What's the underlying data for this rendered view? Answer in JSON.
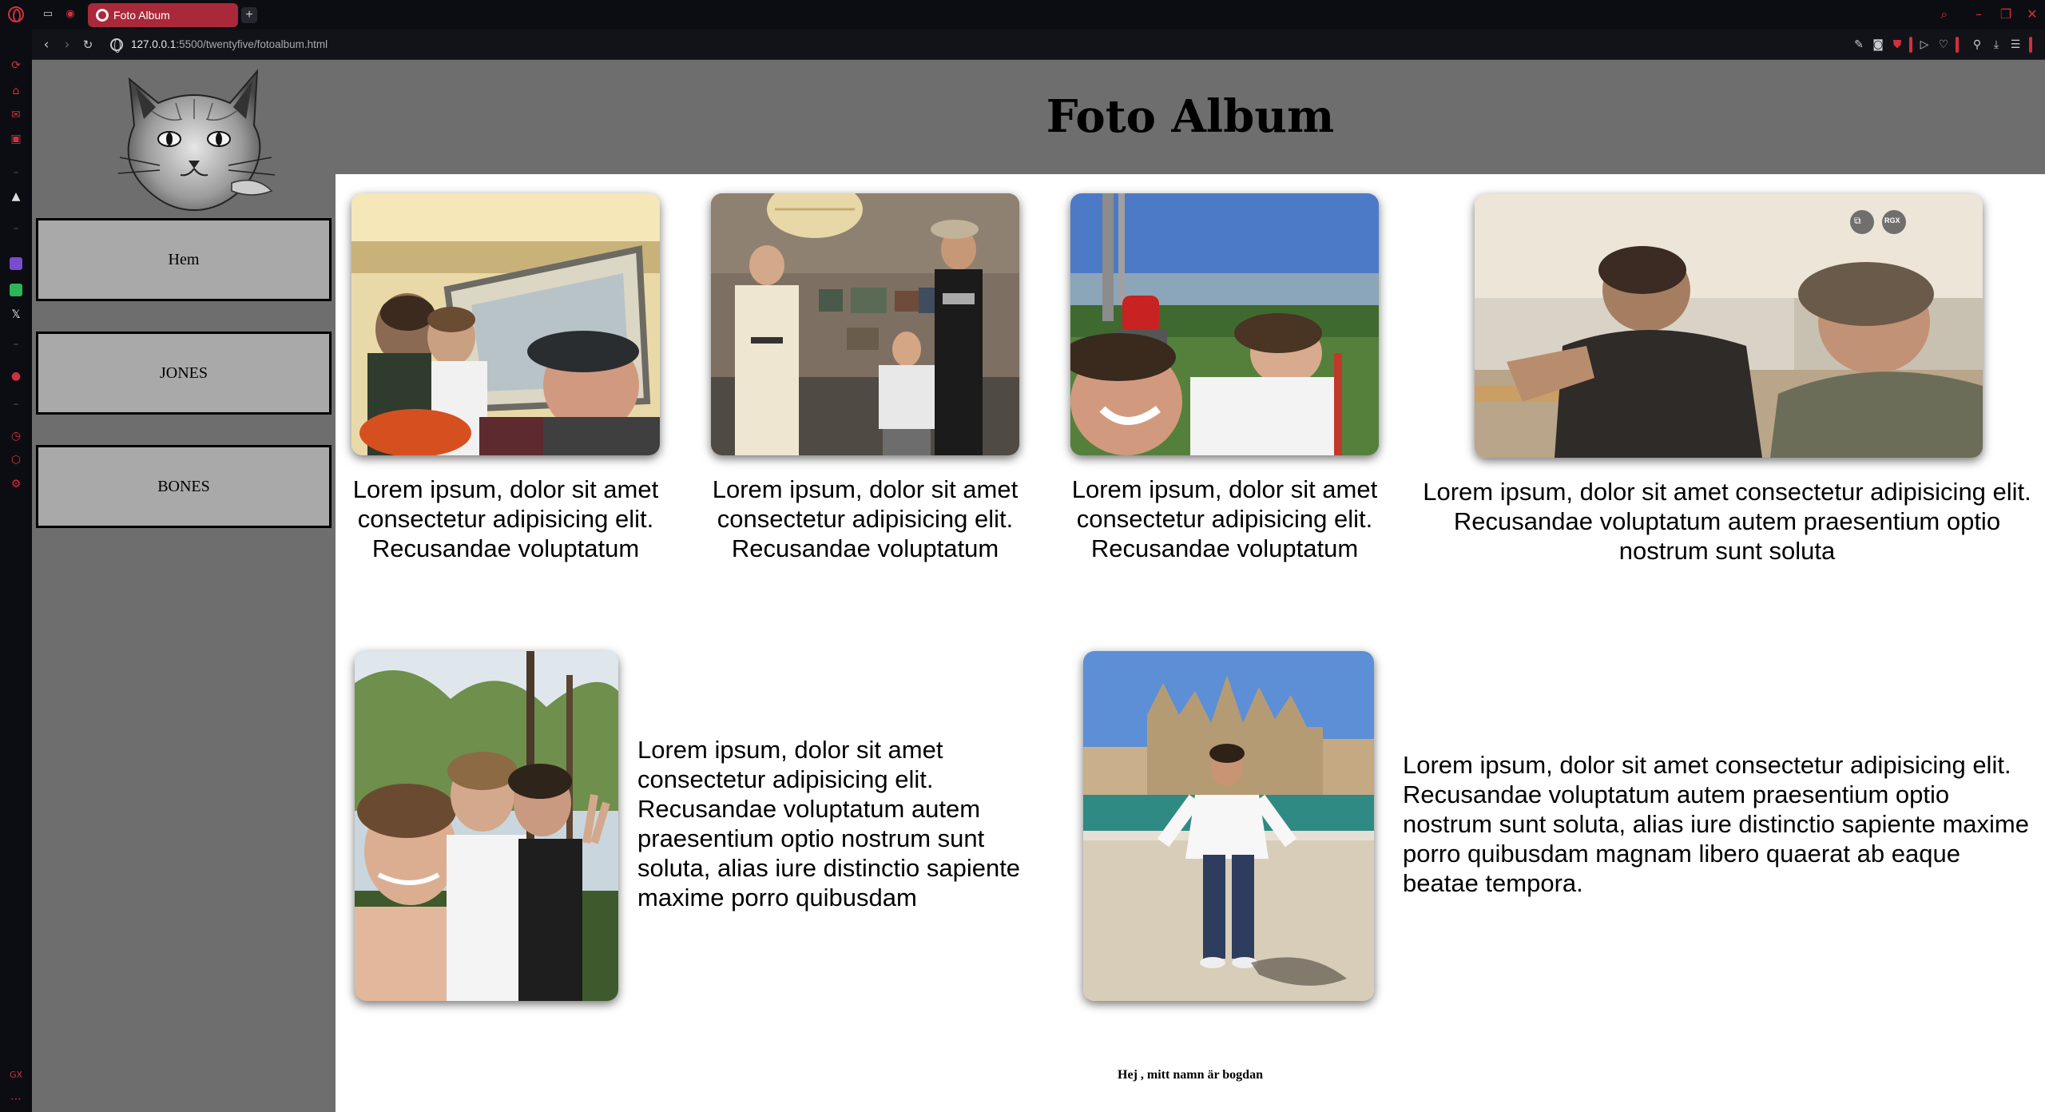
{
  "browser": {
    "tab_title": "Foto Album",
    "url_host": "127.0.0.1",
    "url_rest": ":5500/twentyfive/fotoalbum.html",
    "new_tab_label": "+",
    "accent_color": "#d2303e"
  },
  "page": {
    "title": "Foto Album",
    "nav": [
      {
        "label": "Hem"
      },
      {
        "label": "JONES"
      },
      {
        "label": "BONES"
      }
    ],
    "row1": [
      {
        "caption": "Lorem ipsum, dolor sit amet consectetur adipisicing elit. Recusandae voluptatum"
      },
      {
        "caption": "Lorem ipsum, dolor sit amet consectetur adipisicing elit. Recusandae voluptatum"
      },
      {
        "caption": "Lorem ipsum, dolor sit amet consectetur adipisicing elit. Recusandae voluptatum"
      },
      {
        "caption": "Lorem ipsum, dolor sit amet consectetur adipisicing elit. Recusandae voluptatum autem praesentium optio nostrum sunt soluta",
        "overlay_badge": "RGX"
      }
    ],
    "row2": [
      {
        "caption": "Lorem ipsum, dolor sit amet consectetur adipisicing elit. Recusandae voluptatum autem praesentium optio nostrum sunt soluta, alias iure distinctio sapiente maxime porro quibusdam"
      },
      {
        "caption": "Lorem ipsum, dolor sit amet consectetur adipisicing elit. Recusandae voluptatum autem praesentium optio nostrum sunt soluta, alias iure distinctio sapiente maxime porro quibusdam magnam libero quaerat ab eaque beatae tempora."
      }
    ],
    "footer": "Hej , mitt namn är bogdan"
  }
}
